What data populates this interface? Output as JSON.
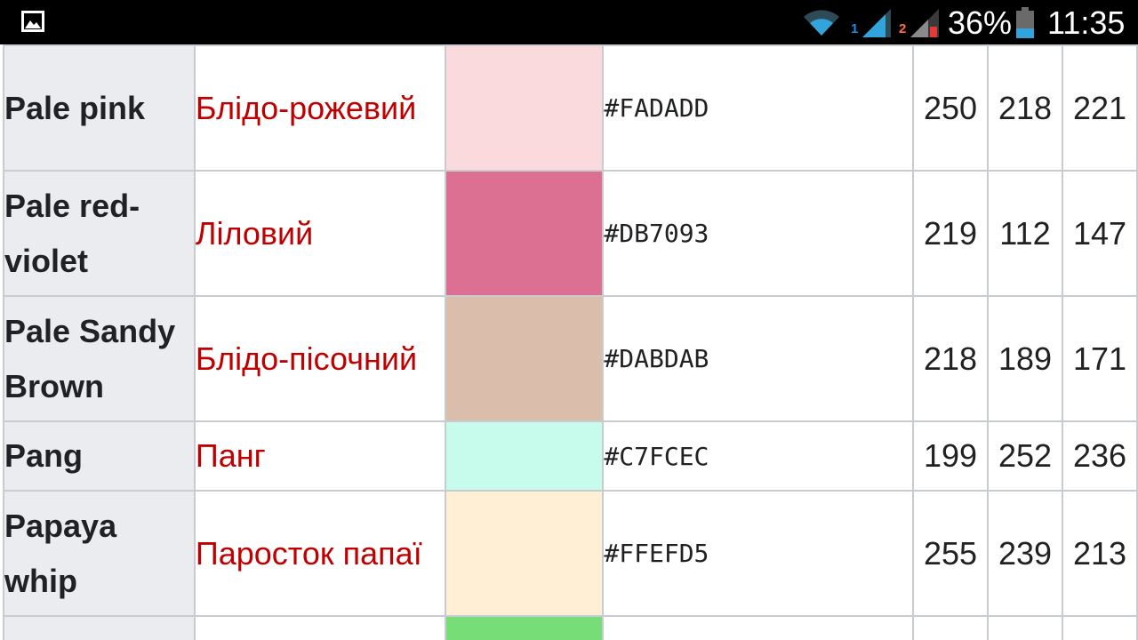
{
  "status_bar": {
    "notification_icon": "gallery-image-icon",
    "wifi_icon": "wifi-icon",
    "sim1_label": "1",
    "sim2_label": "2",
    "sim1_color": "#1e88e5",
    "sim2_color": "#ff7043",
    "sim2_error_color": "#e53935",
    "battery_percent": "36%",
    "battery_color": "#33a3dc",
    "time": "11:35"
  },
  "table": {
    "border_color": "#c8ccd1",
    "rows": [
      {
        "en": "",
        "uk": "",
        "swatch": "#9c6b6e",
        "hex": "",
        "r": "",
        "g": "",
        "b": ""
      },
      {
        "en": "Pale pink",
        "uk": "Блідо-рожевий",
        "swatch": "#FADADD",
        "hex": "#FADADD",
        "r": "250",
        "g": "218",
        "b": "221"
      },
      {
        "en": "Pale red-violet",
        "uk": "Ліловий",
        "swatch": "#DB7093",
        "hex": "#DB7093",
        "r": "219",
        "g": "112",
        "b": "147"
      },
      {
        "en": "Pale Sandy Brown",
        "uk": "Блідо-пісочний",
        "swatch": "#DABDAB",
        "hex": "#DABDAB",
        "r": "218",
        "g": "189",
        "b": "171"
      },
      {
        "en": "Pang",
        "uk": "Панг",
        "swatch": "#C7FCEC",
        "hex": "#C7FCEC",
        "r": "199",
        "g": "252",
        "b": "236"
      },
      {
        "en": "Papaya whip",
        "uk": "Паросток папаї",
        "swatch": "#FFEFD5",
        "hex": "#FFEFD5",
        "r": "255",
        "g": "239",
        "b": "213"
      },
      {
        "en": "",
        "uk": "",
        "swatch": "#77dd77",
        "hex": "",
        "r": "",
        "g": "",
        "b": ""
      }
    ]
  }
}
